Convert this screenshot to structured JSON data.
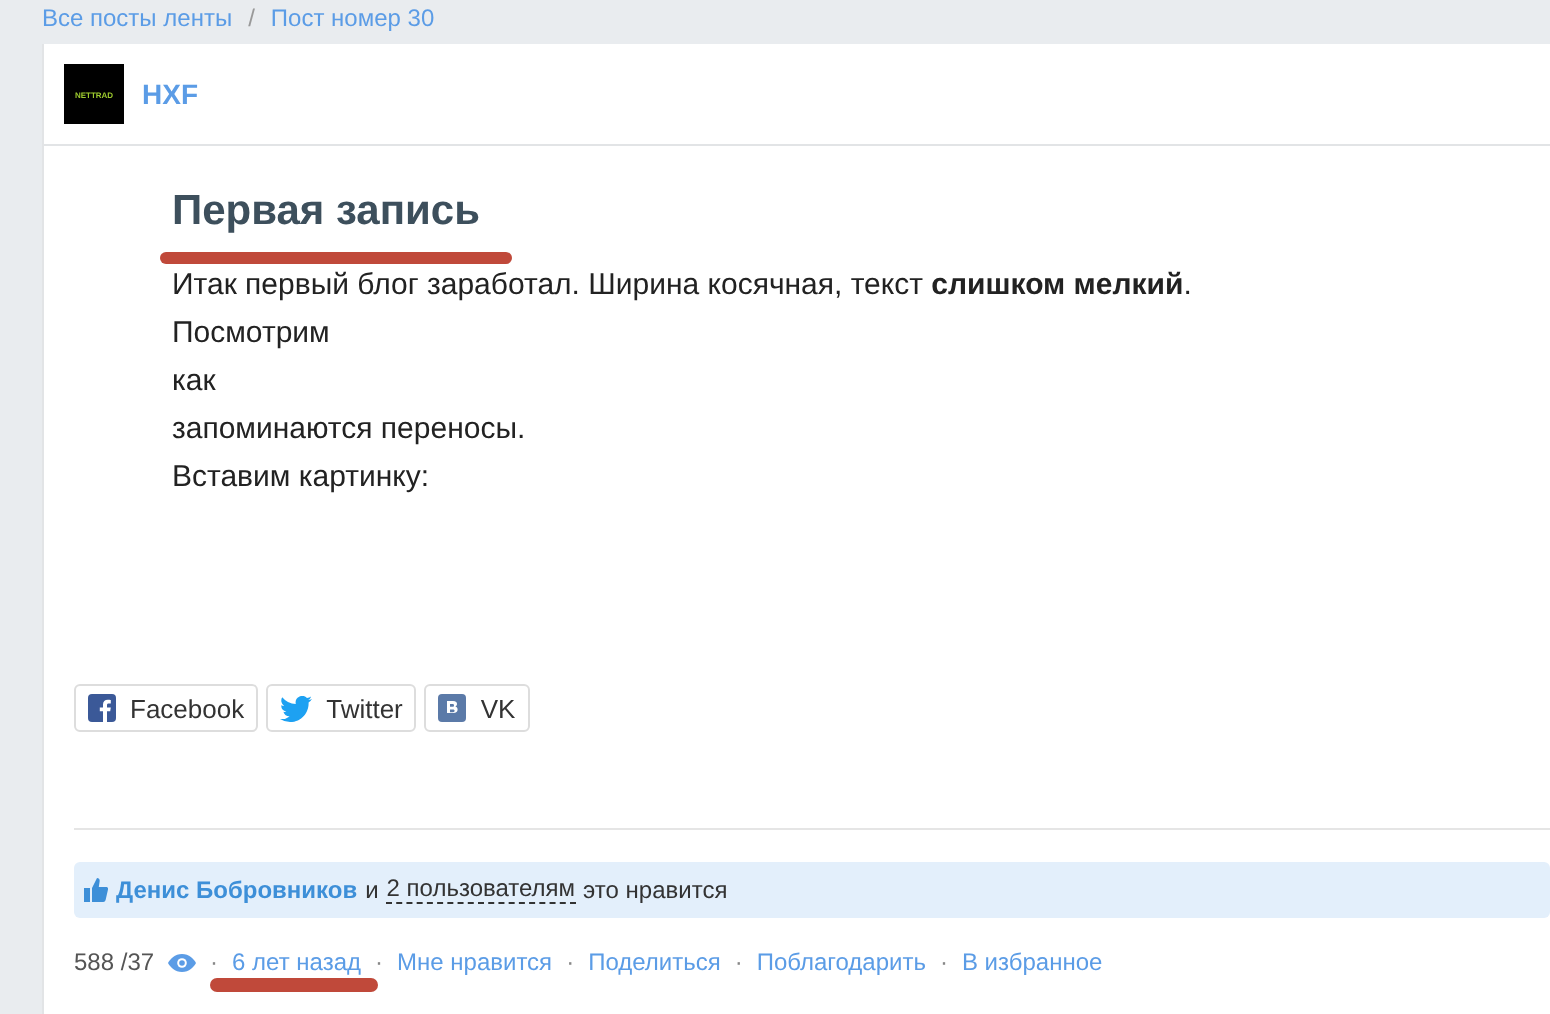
{
  "breadcrumbs": {
    "separator": "/",
    "items": [
      "Все посты ленты",
      "Пост номер 30"
    ]
  },
  "author": {
    "logo_text": "NETTRAD",
    "name": "HXF"
  },
  "post": {
    "title": "Первая запись",
    "lines": [
      "Итак первый блог заработал. Ширина косячная, текст **слишком мелкий**.",
      "Посмотрим",
      "как",
      "запоминаются переносы.",
      "Вставим картинку:"
    ]
  },
  "share": [
    {
      "kind": "facebook",
      "label": "Facebook"
    },
    {
      "kind": "twitter",
      "label": "Twitter"
    },
    {
      "kind": "vk",
      "label": "VK"
    }
  ],
  "likes": {
    "user": "Денис Бобровников",
    "and": "и",
    "others": "2 пользователям",
    "suffix": "это нравится"
  },
  "footer": {
    "views": "588 /37",
    "links": [
      "6 лет назад",
      "Мне нравится",
      "Поделиться",
      "Поблагодарить",
      "В избранное"
    ],
    "separator": "·"
  }
}
